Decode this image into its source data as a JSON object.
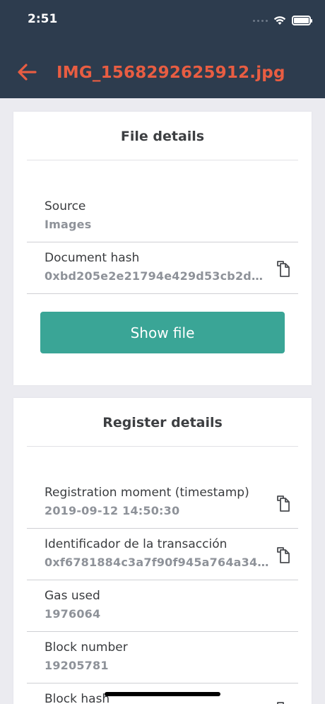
{
  "status_bar": {
    "time": "2:51"
  },
  "header": {
    "title": "IMG_1568292625912.jpg"
  },
  "file_details": {
    "title": "File details",
    "rows": [
      {
        "label": "Source",
        "value": "Images"
      },
      {
        "label": "Document hash",
        "value": "0xbd205e2e21794e429d53cb2de..."
      }
    ],
    "show_file_label": "Show file"
  },
  "register_details": {
    "title": "Register details",
    "rows": [
      {
        "label": "Registration moment (timestamp)",
        "value": "2019-09-12 14:50:30"
      },
      {
        "label": "Identificador de la transacción",
        "value": "0xf6781884c3a7f90f945a764a34..."
      },
      {
        "label": "Gas used",
        "value": "1976064"
      },
      {
        "label": "Block number",
        "value": "19205781"
      },
      {
        "label": "Block hash",
        "value": ""
      }
    ]
  },
  "colors": {
    "header_bg": "#2d3c4e",
    "accent": "#e85d42",
    "button": "#3aa596",
    "page_bg": "#ebebf0"
  },
  "icons": {
    "back": "arrow-left-icon",
    "copy": "copy-icon",
    "wifi": "wifi-icon",
    "battery": "battery-icon"
  }
}
